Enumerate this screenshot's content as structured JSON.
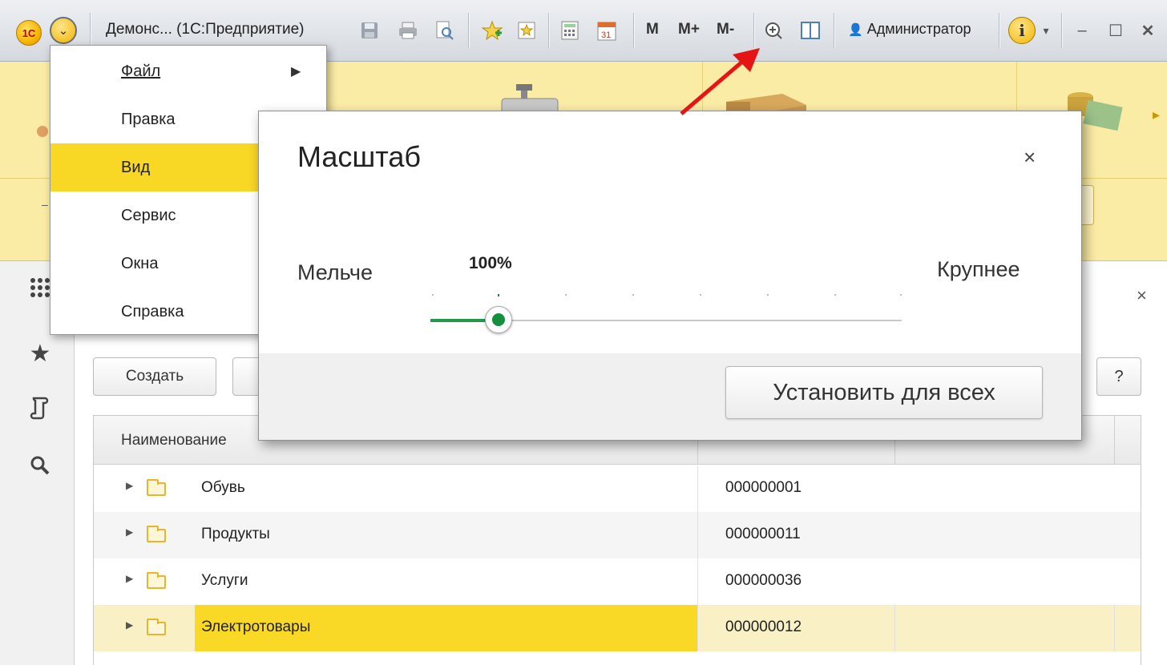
{
  "titlebar": {
    "app_logo": "1С",
    "window_title": "Демонс... (1С:Предприятие)",
    "memory_buttons": [
      "M",
      "M+",
      "M-"
    ],
    "user": "Администратор",
    "icons": [
      "save-icon",
      "print-icon",
      "preview-icon",
      "favorites-add-icon",
      "favorites-icon",
      "calculator-icon",
      "calendar-icon",
      "zoom-icon",
      "panels-icon",
      "info-icon",
      "minimize-icon",
      "maximize-icon",
      "close-icon"
    ],
    "calendar_day": "31",
    "close_glyph": "✕",
    "maximize_glyph": "☐",
    "minimize_glyph": "–"
  },
  "main_menu": {
    "items": [
      {
        "label": "Файл",
        "submenu": true
      },
      {
        "label": "Правка",
        "submenu": false
      },
      {
        "label": "Вид",
        "submenu": false,
        "active": true
      },
      {
        "label": "Сервис",
        "submenu": false
      },
      {
        "label": "Окна",
        "submenu": false
      },
      {
        "label": "Справка",
        "submenu": false
      }
    ]
  },
  "scale_dialog": {
    "title": "Масштаб",
    "close_glyph": "×",
    "label_smaller": "Мельче",
    "label_larger": "Крупнее",
    "current_value": "100%",
    "slider_position": 1,
    "slider_steps": 8,
    "apply_all_button": "Установить для всех"
  },
  "form": {
    "create_button": "Создать",
    "help_button": "?",
    "close_glyph": "×",
    "columns": [
      "Наименование"
    ],
    "rows": [
      {
        "name": "Обувь",
        "code": "000000001"
      },
      {
        "name": "Продукты",
        "code": "000000011"
      },
      {
        "name": "Услуги",
        "code": "000000036"
      },
      {
        "name": "Электротовары",
        "code": "000000012",
        "selected": true
      }
    ]
  },
  "colors": {
    "sections_bg": "#fbeca5",
    "highlight": "#f9d725",
    "slider_accent": "#138f3e",
    "pointer_arrow": "#e51515"
  }
}
